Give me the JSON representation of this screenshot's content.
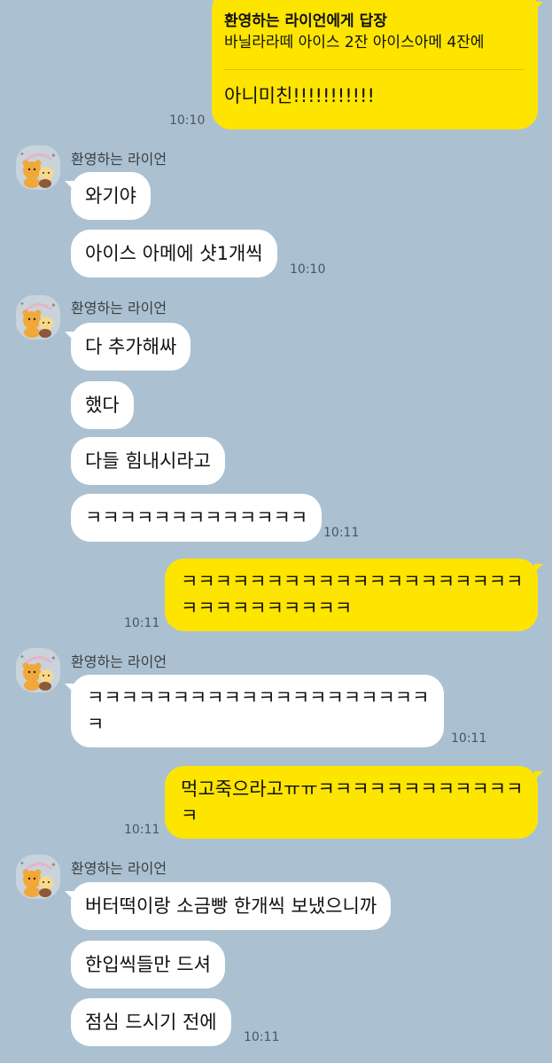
{
  "colors": {
    "background": "#abc1d1",
    "my_bubble": "#fee500",
    "their_bubble": "#ffffff"
  },
  "messages": {
    "reply": {
      "header": "환영하는 라이언에게 답장",
      "quoted": "바닐라라떼 아이스 2잔 아이스아메 4잔에",
      "text": "아니미친!!!!!!!!!!!",
      "time": "10:10"
    },
    "group1": {
      "sender": "환영하는 라이언",
      "avatar_icon": "ryan-choonsik-avatar-icon",
      "items": [
        {
          "text": "와기야"
        },
        {
          "text": "아이스 아메에 샷1개씩",
          "time": "10:10"
        }
      ]
    },
    "group2": {
      "sender": "환영하는 라이언",
      "avatar_icon": "ryan-choonsik-avatar-icon",
      "items": [
        {
          "text": "다 추가해싸"
        },
        {
          "text": "했다"
        },
        {
          "text": "다들 힘내시라고"
        },
        {
          "text": "ㅋㅋㅋㅋㅋㅋㅋㅋㅋㅋㅋㅋㅋ",
          "time": "10:11"
        }
      ]
    },
    "mine1": {
      "line1": "ㅋㅋㅋㅋㅋㅋㅋㅋㅋㅋㅋㅋㅋㅋㅋㅋㅋㅋㅋㅋ",
      "line2": "ㅋㅋㅋㅋㅋㅋㅋㅋㅋㅋ",
      "time": "10:11"
    },
    "group3": {
      "sender": "환영하는 라이언",
      "avatar_icon": "ryan-choonsik-avatar-icon",
      "line1": "ㅋㅋㅋㅋㅋㅋㅋㅋㅋㅋㅋㅋㅋㅋㅋㅋㅋㅋㅋㅋ",
      "line2": "ㅋ",
      "time": "10:11"
    },
    "mine2": {
      "line1": "먹고죽으라고ㅠㅠㅋㅋㅋㅋㅋㅋㅋㅋㅋㅋㅋㅋ",
      "line2": "ㅋ",
      "time": "10:11"
    },
    "group4": {
      "sender": "환영하는 라이언",
      "avatar_icon": "ryan-choonsik-avatar-icon",
      "items": [
        {
          "text": "버터떡이랑 소금빵 한개씩 보냈으니까"
        },
        {
          "text": "한입씩들만 드셔"
        },
        {
          "text": "점심 드시기 전에",
          "time": "10:11"
        }
      ]
    }
  }
}
